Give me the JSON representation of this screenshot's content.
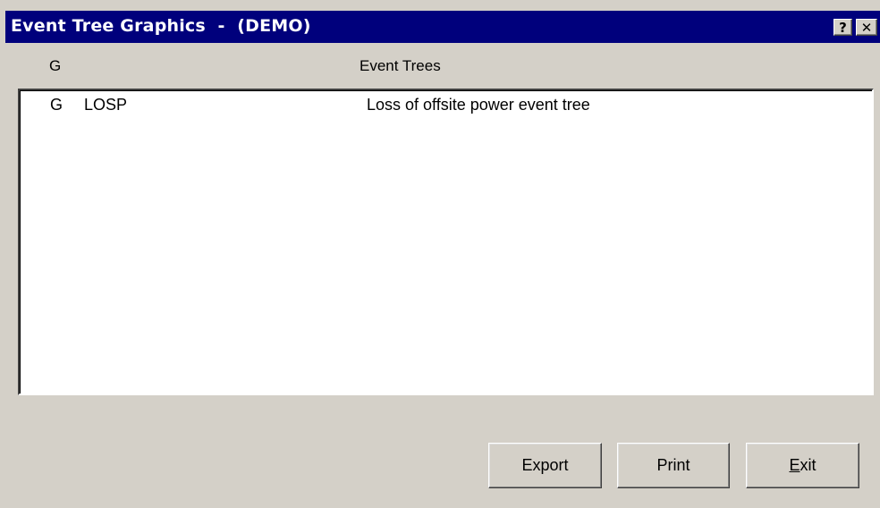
{
  "window": {
    "title": "Event Tree Graphics  -  (DEMO)",
    "help_glyph": "?",
    "close_glyph": "✕",
    "titlebar_color": "#00007c",
    "face_color": "#d4d0c8"
  },
  "columns": {
    "g": "G",
    "event_trees": "Event Trees"
  },
  "rows": [
    {
      "g": "G",
      "name": "LOSP",
      "description": "Loss of offsite power event tree"
    }
  ],
  "buttons": {
    "export": "Export",
    "print": "Print",
    "exit_first": "E",
    "exit_rest": "xit"
  }
}
